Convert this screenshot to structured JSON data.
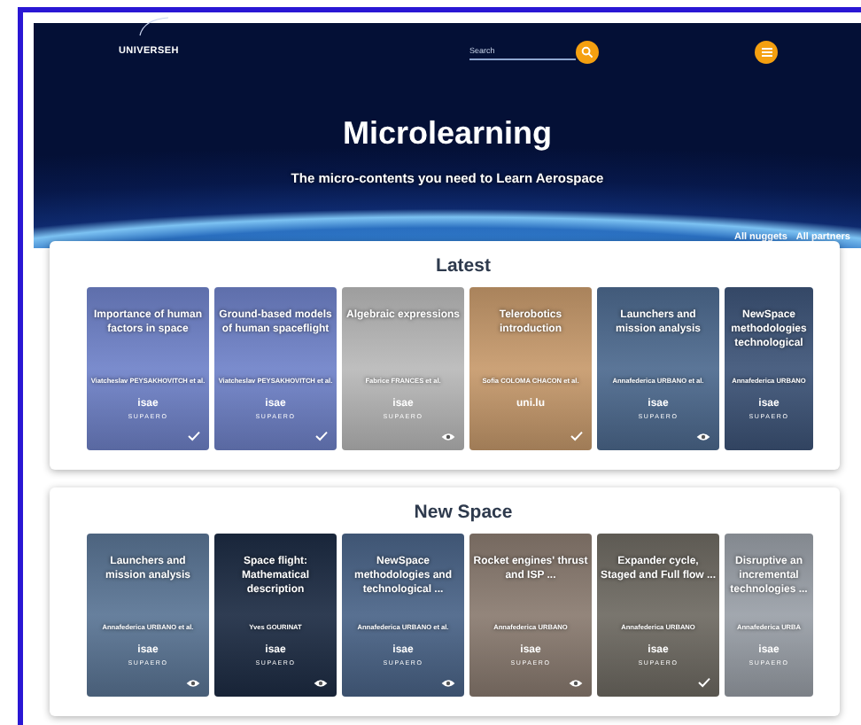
{
  "header": {
    "logo": "UNIVERSEH",
    "search": {
      "placeholder": "Search"
    }
  },
  "hero": {
    "title": "Microlearning",
    "subtitle": "The micro-contents you need to Learn Aerospace",
    "links": [
      "All nuggets",
      "All partners"
    ]
  },
  "sections": [
    {
      "title": "Latest",
      "nuggets": [
        {
          "title": "Importance of human factors in space",
          "author": "Viatcheslav PEYSAKHOVITCH et al.",
          "partner": {
            "name": "isae",
            "sub": "SUPAERO"
          },
          "completed": true,
          "color": "#6f82c9",
          "partial": false
        },
        {
          "title": "Ground-based models of human spaceflight",
          "author": "Viatcheslav PEYSAKHOVITCH et al.",
          "partner": {
            "name": "isae",
            "sub": "SUPAERO"
          },
          "completed": true,
          "color": "#6f82c9",
          "partial": false
        },
        {
          "title": "Algebraic expressions",
          "author": "Fabrice FRANCES et al.",
          "partner": {
            "name": "isae",
            "sub": "SUPAERO"
          },
          "completed": false,
          "color": "#b9b9b9",
          "partial": false
        },
        {
          "title": "Telerobotics introduction",
          "author": "Sofia COLOMA CHACON et al.",
          "partner": {
            "name": "uni.lu"
          },
          "completed": true,
          "color": "#c79a6c",
          "partial": false
        },
        {
          "title": "Launchers and mission analysis",
          "author": "Annafederica URBANO et al.",
          "partner": {
            "name": "isae",
            "sub": "SUPAERO"
          },
          "completed": false,
          "color": "#4d6a8f",
          "partial": false
        },
        {
          "title": "NewSpace methodologies technological",
          "author": "Annafederica URBANO",
          "partner": {
            "name": "isae",
            "sub": "SUPAERO"
          },
          "color": "#3d5478",
          "partial": true
        }
      ]
    },
    {
      "title": "New Space",
      "nuggets": [
        {
          "title": "Launchers and mission analysis",
          "author": "Annafederica URBANO et al.",
          "partner": {
            "name": "isae",
            "sub": "SUPAERO"
          },
          "completed": false,
          "color": "#5a7595",
          "partial": false
        },
        {
          "title": "Space flight: Mathematical description",
          "author": "Yves GOURINAT",
          "partner": {
            "name": "isae",
            "sub": "SUPAERO"
          },
          "completed": false,
          "color": "#1d2c44",
          "partial": false
        },
        {
          "title": "NewSpace methodologies and technological ...",
          "author": "Annafederica URBANO et al.",
          "partner": {
            "name": "isae",
            "sub": "SUPAERO"
          },
          "completed": false,
          "color": "#4a6488",
          "partial": false
        },
        {
          "title": "Rocket engines' thrust and ISP ...",
          "author": "Annafederica URBANO",
          "partner": {
            "name": "isae",
            "sub": "SUPAERO"
          },
          "completed": false,
          "color": "#8a7b70",
          "partial": false
        },
        {
          "title": "Expander cycle, Staged and Full flow ...",
          "author": "Annafederica URBANO",
          "partner": {
            "name": "isae",
            "sub": "SUPAERO"
          },
          "completed": true,
          "color": "#6e6a62",
          "partial": false
        },
        {
          "title": "Disruptive an incremental technologies ...",
          "author": "Annafederica URBA",
          "partner": {
            "name": "isae",
            "sub": "SUPAERO"
          },
          "color": "#9aa0a8",
          "partial": true
        }
      ]
    }
  ]
}
